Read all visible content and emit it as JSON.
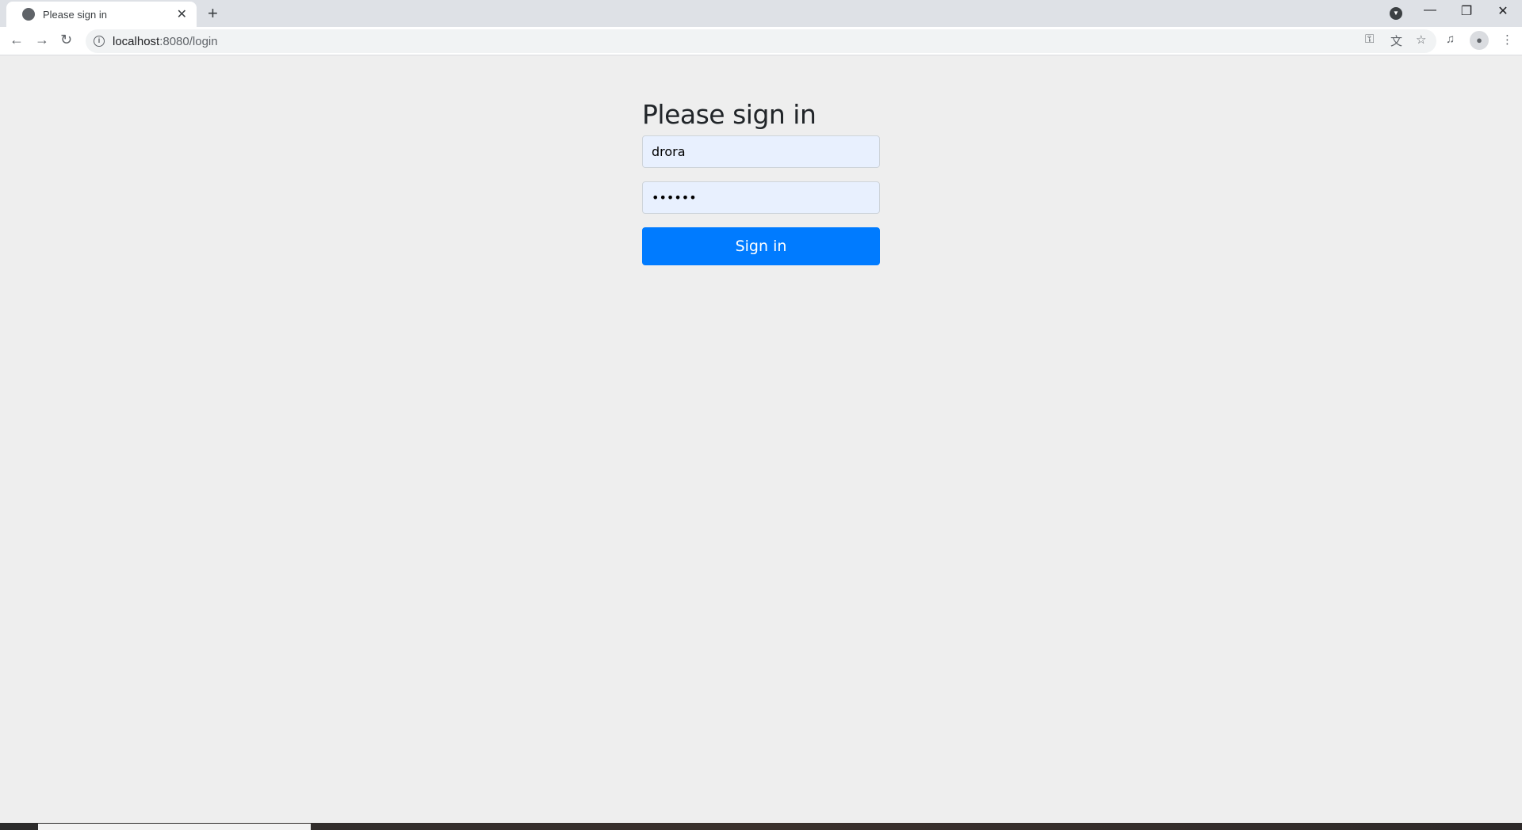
{
  "browser": {
    "tab_title": "Please sign in",
    "url_host": "localhost",
    "url_rest": ":8080/login",
    "icons": [
      "globe-icon",
      "close-icon",
      "plus-icon",
      "back-icon",
      "forward-icon",
      "reload-icon",
      "info-icon",
      "key-icon",
      "translate-icon",
      "star-icon",
      "media-icon",
      "avatar-icon",
      "more-icon",
      "minimize-icon",
      "restore-icon"
    ]
  },
  "form": {
    "heading": "Please sign in",
    "username_value": "drora",
    "password_value": "dddddd",
    "submit_label": "Sign in",
    "accent_color": "#007bff"
  }
}
